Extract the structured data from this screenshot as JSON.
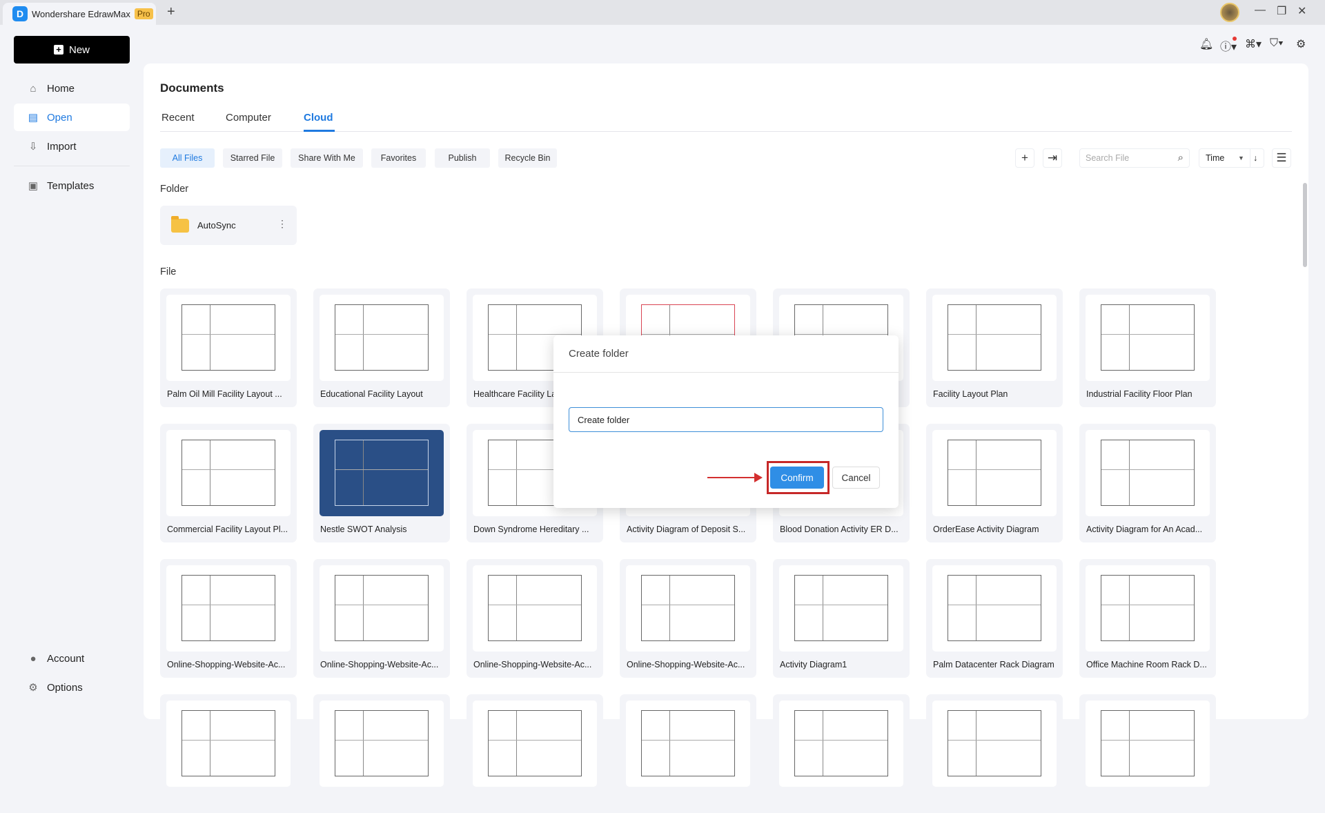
{
  "app": {
    "title": "Wondershare EdrawMax",
    "badge": "Pro",
    "new_tab": "+",
    "avatar": "user-avatar"
  },
  "window": {
    "minimize": "—",
    "restore": "❐",
    "close": "✕"
  },
  "top_icons": [
    "bell-icon",
    "help-icon",
    "apps-icon",
    "shirt-icon",
    "gear-icon"
  ],
  "sidebar": {
    "new_label": "New",
    "items": [
      {
        "label": "Home",
        "icon": "⌂"
      },
      {
        "label": "Open",
        "icon": "▤"
      },
      {
        "label": "Import",
        "icon": "⇩"
      },
      {
        "label": "Templates",
        "icon": "▣"
      }
    ],
    "bottom": [
      {
        "label": "Account",
        "icon": "●"
      },
      {
        "label": "Options",
        "icon": "⚙"
      }
    ]
  },
  "main": {
    "title": "Documents",
    "tabs": [
      "Recent",
      "Computer",
      "Cloud"
    ],
    "active_tab": "Cloud",
    "filters": [
      "All Files",
      "Starred File",
      "Share With Me",
      "Favorites",
      "Publish",
      "Recycle Bin"
    ],
    "search_placeholder": "Search File",
    "sort": "Time",
    "folder_label": "Folder",
    "folders": [
      "AutoSync"
    ],
    "file_label": "File",
    "files": [
      "Palm Oil Mill Facility Layout ...",
      "Educational Facility Layout",
      "Healthcare Facility La...",
      "",
      "...",
      "Facility Layout Plan",
      "Industrial Facility Floor Plan",
      "Commercial Facility Layout Pl...",
      "Nestle SWOT Analysis",
      "Down Syndrome Hereditary ...",
      "Activity Diagram of Deposit S...",
      "Blood Donation Activity ER D...",
      "OrderEase Activity Diagram",
      "Activity Diagram for An Acad...",
      "Online-Shopping-Website-Ac...",
      "Online-Shopping-Website-Ac...",
      "Online-Shopping-Website-Ac...",
      "Online-Shopping-Website-Ac...",
      "Activity Diagram1",
      "Palm Datacenter Rack Diagram",
      "Office Machine Room Rack D..."
    ]
  },
  "dialog": {
    "title": "Create folder",
    "input_value": "Create folder",
    "confirm": "Confirm",
    "cancel": "Cancel"
  },
  "colors": {
    "accent": "#1f7ae0",
    "confirm": "#2f8ee6",
    "highlight": "#c62828"
  }
}
